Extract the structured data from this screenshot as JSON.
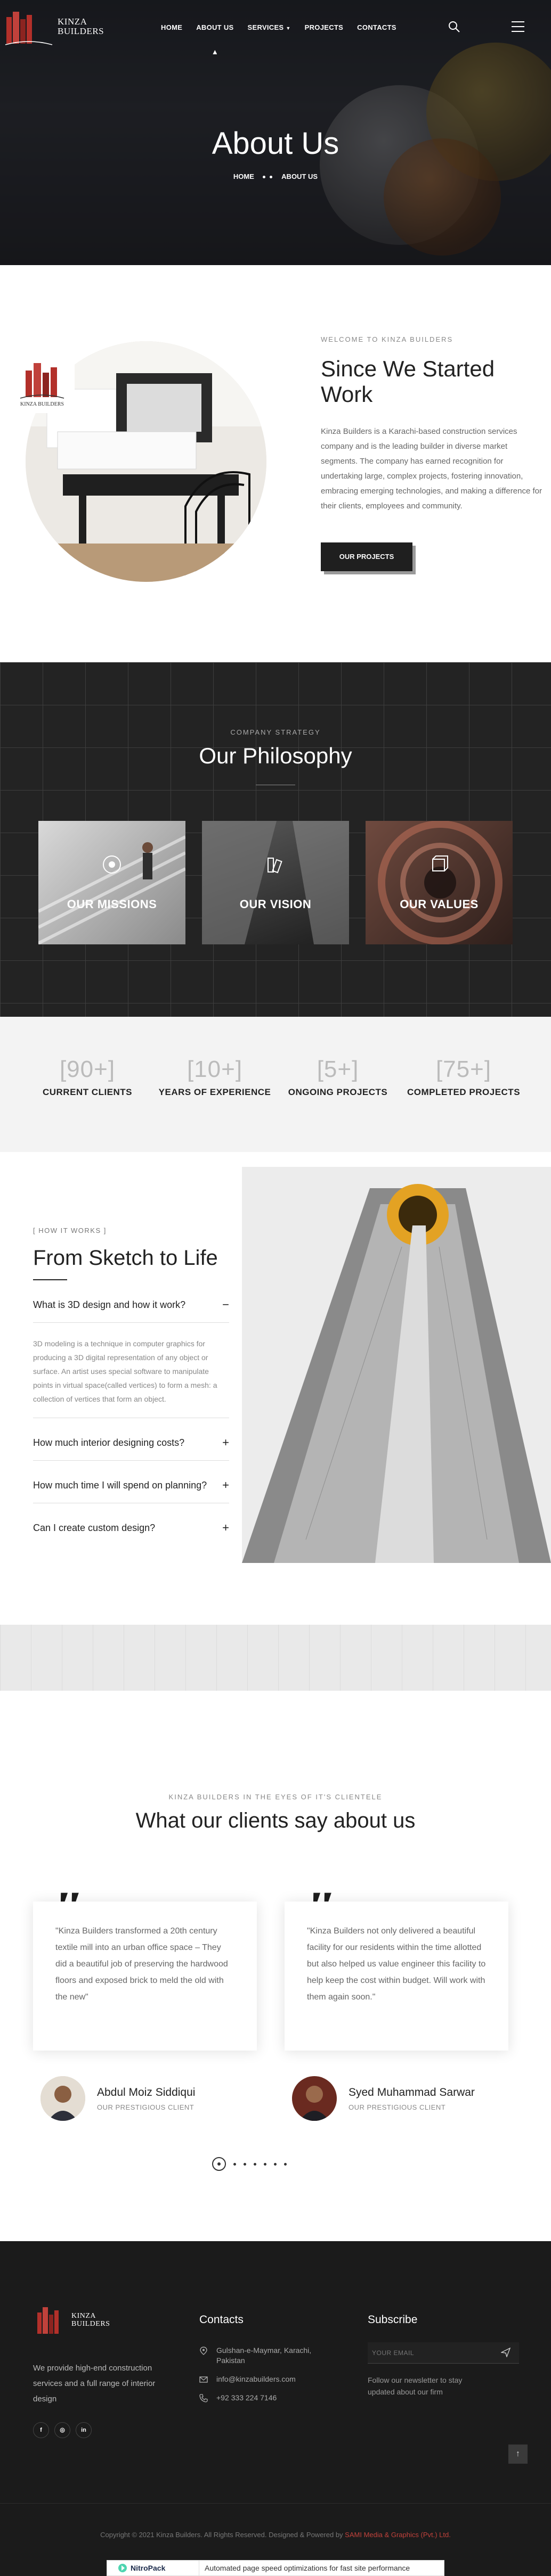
{
  "brand": {
    "name_line1": "KINZA",
    "name_line2": "BUILDERS",
    "small_logo_text": "KINZA BUILDERS",
    "accent": "#c0413b"
  },
  "nav": {
    "items": [
      {
        "label": "HOME"
      },
      {
        "label": "ABOUT US"
      },
      {
        "label": "SERVICES"
      },
      {
        "label": "PROJECTS"
      },
      {
        "label": "CONTACTS"
      }
    ],
    "search_icon": "search-icon",
    "menu_icon": "hamburger-icon"
  },
  "hero": {
    "title": "About Us",
    "breadcrumb": [
      "HOME",
      "ABOUT US"
    ]
  },
  "about": {
    "eyebrow": "WELCOME TO KINZA BUILDERS",
    "title": "Since We Started Work",
    "body": "Kinza Builders is a Karachi-based construction services company and is the leading builder in diverse market segments. The company has earned recognition for undertaking large, complex projects, fostering innovation, embracing emerging technologies, and making a difference for their clients, employees and community.",
    "button": "OUR PROJECTS"
  },
  "philosophy": {
    "eyebrow": "COMPANY STRATEGY",
    "title": "Our Philosophy",
    "cards": [
      {
        "label": "OUR MISSIONS"
      },
      {
        "label": "OUR VISION"
      },
      {
        "label": "OUR VALUES"
      }
    ]
  },
  "stats": [
    {
      "value": "[90+]",
      "label": "CURRENT CLIENTS"
    },
    {
      "value": "[10+]",
      "label": "YEARS OF EXPERIENCE"
    },
    {
      "value": "[5+]",
      "label": "ONGOING PROJECTS"
    },
    {
      "value": "[75+]",
      "label": "COMPLETED PROJECTS"
    }
  ],
  "faq": {
    "eyebrow": "[ HOW IT WORKS ]",
    "title": "From Sketch to Life",
    "items": [
      {
        "q": "What is 3D design and how it work?",
        "sign": "−",
        "a": "3D modeling is a technique in computer graphics for producing a 3D digital representation of any object or surface. An artist uses special software to manipulate points in virtual space(called vertices) to form a mesh: a collection of vertices that form an object."
      },
      {
        "q": "How much interior designing costs?",
        "sign": "+"
      },
      {
        "q": "How much time I will spend on planning?",
        "sign": "+"
      },
      {
        "q": "Can I create custom design?",
        "sign": "+"
      }
    ]
  },
  "testimonials": {
    "eyebrow": "KINZA BUILDERS IN THE EYES OF IT'S CLIENTELE",
    "title": "What our clients say about us",
    "items": [
      {
        "quote": "\"Kinza Builders transformed a 20th century textile mill into an urban office space – They did a beautiful job of preserving the hardwood floors and exposed brick to meld the old with the new\"",
        "name": "Abdul Moiz Siddiqui",
        "role": "OUR PRESTIGIOUS CLIENT"
      },
      {
        "quote": "\"Kinza Builders not only delivered a beautiful facility for our residents within the time allotted but also helped us value engineer this facility to help keep the cost within budget. Will work with them again soon.\"",
        "name": "Syed Muhammad Sarwar",
        "role": "OUR PRESTIGIOUS CLIENT"
      }
    ],
    "dots": 7
  },
  "footer": {
    "description": "We provide high-end construction services and a full range of interior design",
    "socials": [
      "f",
      "◎",
      "in"
    ],
    "contacts_title": "Contacts",
    "address": "Gulshan-e-Maymar, Karachi, Pakistan",
    "email": "info@kinzabuilders.com",
    "phone": "+92 333 224 7146",
    "subscribe_title": "Subscribe",
    "subscribe_placeholder": "YOUR EMAIL",
    "subscribe_note": "Follow our newsletter to stay updated about our firm",
    "copyright": "Copyright © 2021 Kinza Builders. All Rights Reserved. Designed & Powered by ",
    "credit": "SAMI Media & Graphics (Pvt.) Ltd.",
    "totop": "↑"
  },
  "nitropack": {
    "logo": "NitroPack",
    "text": "Automated page speed optimizations for fast site performance"
  }
}
